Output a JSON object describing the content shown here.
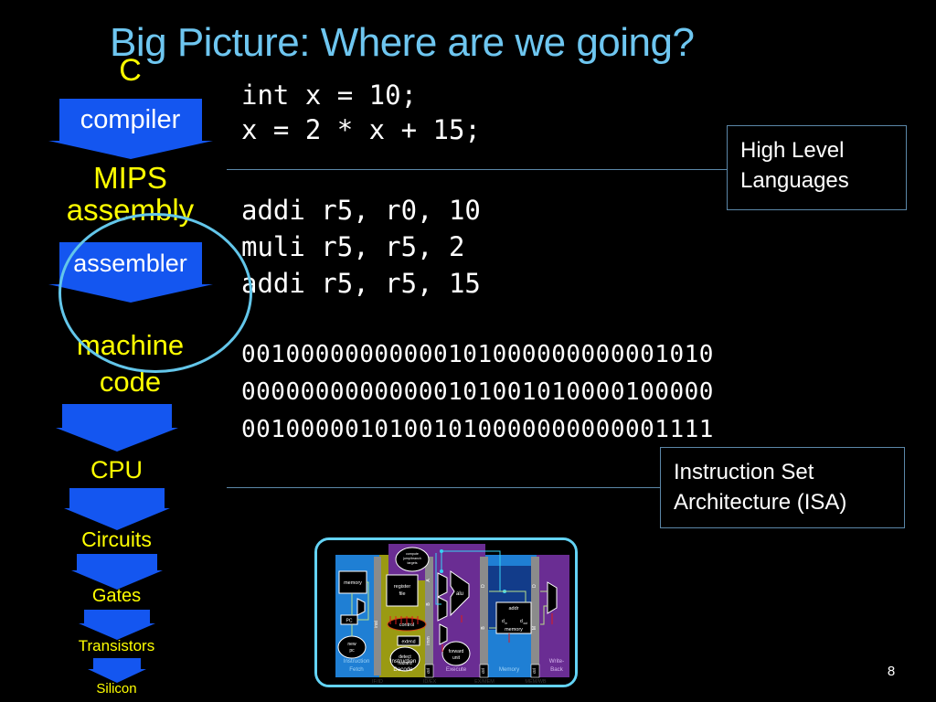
{
  "slide": {
    "title": "Big Picture: Where are we going?",
    "page_number": "8",
    "background_color": "#000000",
    "title_color": "#6ec6f0"
  },
  "stack": {
    "accent_color": "#1456f0",
    "label_color": "#ffff00",
    "highlight_circle_color": "#63c6ea",
    "layers": [
      {
        "label": "C"
      },
      {
        "label": "MIPS\nassembly"
      },
      {
        "label": "machine\ncode"
      },
      {
        "label": "CPU"
      },
      {
        "label": "Circuits"
      },
      {
        "label": "Gates"
      },
      {
        "label": "Transistors"
      },
      {
        "label": "Silicon"
      }
    ],
    "arrows": [
      {
        "label": "compiler"
      },
      {
        "label": "assembler"
      },
      {
        "label": ""
      },
      {
        "label": ""
      },
      {
        "label": ""
      },
      {
        "label": ""
      },
      {
        "label": ""
      }
    ]
  },
  "code": {
    "high_level": "int x = 10;\nx = 2 * x + 15;",
    "assembly": "addi r5, r0, 10\nmuli r5, r5, 2\naddi r5, r5, 15",
    "machine": "00100000000000101000000000001010\n00000000000000101001010000100000\n00100000101001010000000000001111"
  },
  "callouts": [
    {
      "name": "high-level-languages",
      "text": "High Level\nLanguages"
    },
    {
      "name": "instruction-set-architecture",
      "text": "Instruction Set\nArchitecture (ISA)"
    }
  ],
  "datapath": {
    "border_color": "#63d3f5",
    "stages": [
      {
        "name": "Instruction Fetch",
        "label": "Instruction\nFetch",
        "color": "#1f7fd4"
      },
      {
        "name": "Instruction Decode",
        "label": "Instruction\nDecode",
        "color": "#9a9a12"
      },
      {
        "name": "Execute",
        "label": "Execute",
        "color": "#6a2d93"
      },
      {
        "name": "Memory",
        "label": "Memory",
        "color": "#1f7fd4"
      },
      {
        "name": "Write-Back",
        "label": "Write-\nBack",
        "color": "#6a2d93"
      }
    ],
    "blocks": [
      "memory",
      "PC",
      "new pc",
      "register file",
      "compute jump/branch targets",
      "control",
      "extend",
      "detect hazard",
      "alu",
      "forward unit",
      "addr",
      "memory",
      "d_in",
      "d_out"
    ],
    "pipeline_registers": [
      "inst",
      "A",
      "B",
      "imm",
      "ctrl",
      "D",
      "B",
      "ctrl",
      "D",
      "M",
      "ctrl"
    ],
    "stage_boundaries": [
      "IF/ID",
      "ID/EX",
      "EX/MEM",
      "MEM/WB"
    ]
  }
}
